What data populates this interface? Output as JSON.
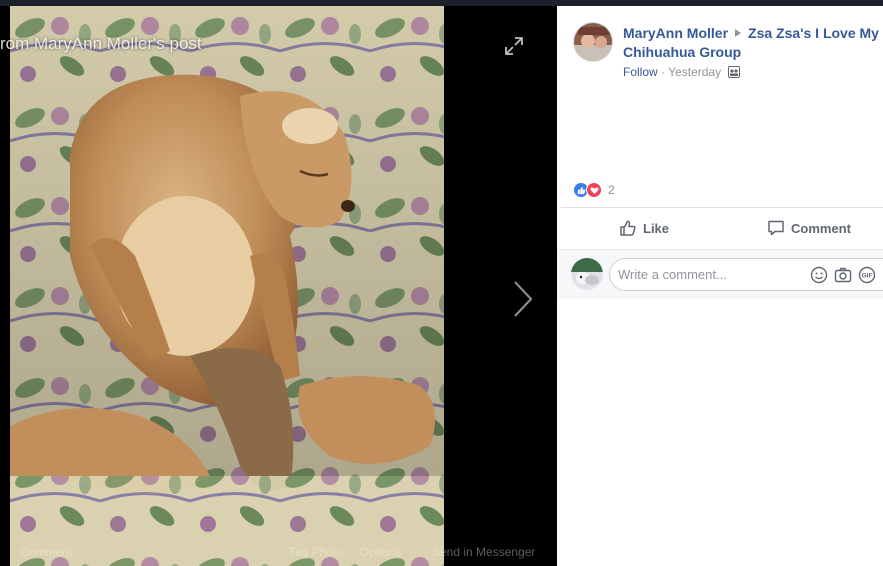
{
  "viewer": {
    "from_label": "rom MaryAnn Moller's post",
    "actions": {
      "comment": "Comment",
      "tag": "Tag Photo",
      "options": "Options",
      "send": "Send in Messenger"
    }
  },
  "post": {
    "author": "MaryAnn Moller",
    "group": "Zsa Zsa's I Love My Chihuahua Group",
    "follow": "Follow",
    "time": "Yesterday",
    "reaction_count": "2",
    "like_label": "Like",
    "comment_label": "Comment",
    "comment_placeholder": "Write a comment..."
  },
  "icons": {
    "expand": "expand-icon",
    "next": "chevron-right-icon",
    "audience": "group-audience-icon",
    "like_reaction": "thumbs-up-icon",
    "love_reaction": "heart-icon",
    "emoji": "emoji-icon",
    "camera": "camera-icon",
    "gif": "gif-icon"
  },
  "colors": {
    "link": "#365899",
    "meta": "#90949c",
    "like_blue": "#3b7cf0",
    "love_red": "#f0415a"
  }
}
